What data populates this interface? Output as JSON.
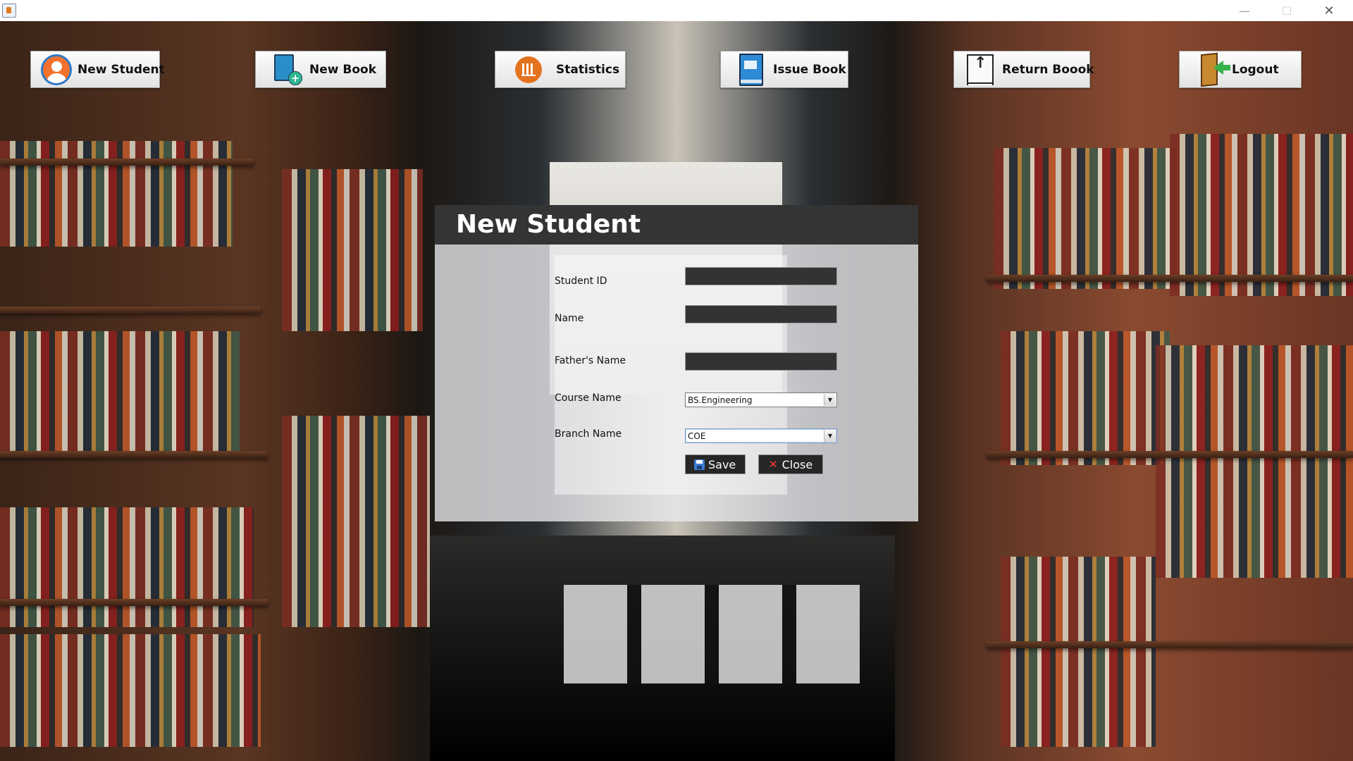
{
  "window": {
    "title": "",
    "controls": {
      "minimize": "—",
      "maximize": "☐",
      "close": "✕"
    }
  },
  "toolbar": {
    "buttons": [
      {
        "label": "New Student",
        "icon": "student-icon"
      },
      {
        "label": "New Book",
        "icon": "new-book-icon"
      },
      {
        "label": "Statistics",
        "icon": "statistics-icon"
      },
      {
        "label": "Issue Book",
        "icon": "issue-book-icon"
      },
      {
        "label": "Return Boook",
        "icon": "return-book-icon"
      },
      {
        "label": "Logout",
        "icon": "logout-icon"
      }
    ]
  },
  "dialog": {
    "title": "New Student",
    "fields": {
      "student_id": {
        "label": "Student ID",
        "value": ""
      },
      "name": {
        "label": "Name",
        "value": ""
      },
      "fathers_name": {
        "label": "Father's Name",
        "value": ""
      },
      "course_name": {
        "label": "Course Name",
        "value": "BS.Engineering"
      },
      "branch_name": {
        "label": "Branch Name",
        "value": "COE"
      }
    },
    "buttons": {
      "save": "Save",
      "close": "Close"
    }
  },
  "colors": {
    "header_bg": "#343434",
    "input_bg": "#333333",
    "button_bg": "#262626",
    "close_x": "#ff3b3b"
  }
}
